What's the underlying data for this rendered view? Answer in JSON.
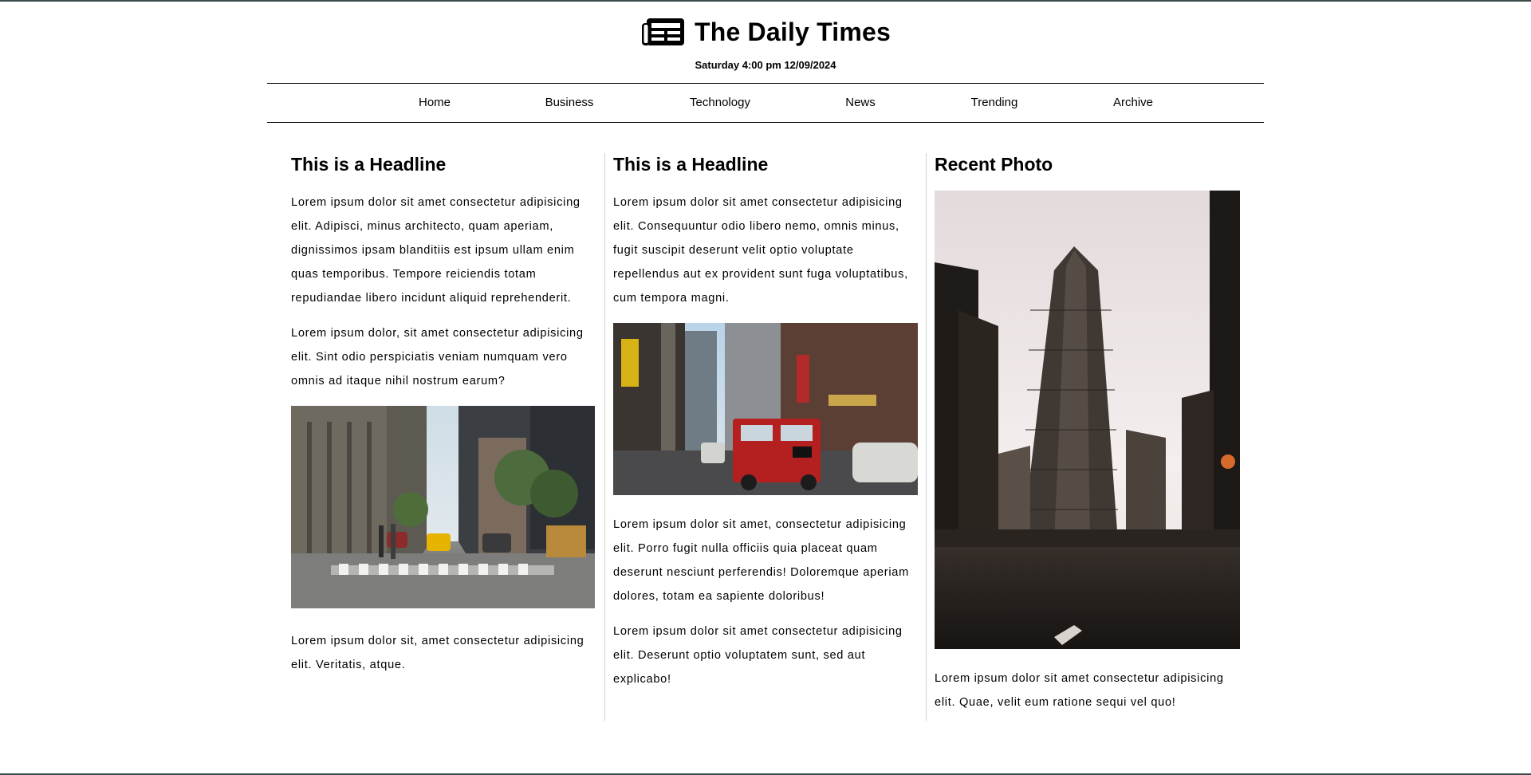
{
  "site": {
    "title": "The Daily Times",
    "dateline": "Saturday 4:00 pm 12/09/2024",
    "logo_icon": "newspaper-icon"
  },
  "nav": {
    "items": [
      {
        "label": "Home"
      },
      {
        "label": "Business"
      },
      {
        "label": "Technology"
      },
      {
        "label": "News"
      },
      {
        "label": "Trending"
      },
      {
        "label": "Archive"
      }
    ]
  },
  "columns": [
    {
      "headline": "This is a Headline",
      "paragraphs": [
        "Lorem ipsum dolor sit amet consectetur adipisicing elit. Adipisci, minus architecto, quam aperiam, dignissimos ipsam blanditiis est ipsum ullam enim quas temporibus. Tempore reiciendis totam repudiandae libero incidunt aliquid reprehenderit.",
        "Lorem ipsum dolor, sit amet consectetur adipisicing elit. Sint odio perspiciatis veniam numquam vero omnis ad itaque nihil nostrum earum?",
        "Lorem ipsum dolor sit, amet consectetur adipisicing elit. Veritatis, atque."
      ]
    },
    {
      "headline": "This is a Headline",
      "paragraphs": [
        "Lorem ipsum dolor sit amet consectetur adipisicing elit. Consequuntur odio libero nemo, omnis minus, fugit suscipit deserunt velit optio voluptate repellendus aut ex provident sunt fuga voluptatibus, cum tempora magni.",
        "Lorem ipsum dolor sit amet, consectetur adipisicing elit. Porro fugit nulla officiis quia placeat quam deserunt nesciunt perferendis! Doloremque aperiam dolores, totam ea sapiente doloribus!",
        "Lorem ipsum dolor sit amet consectetur adipisicing elit. Deserunt optio voluptatem sunt, sed aut explicabo!"
      ]
    },
    {
      "headline": "Recent Photo",
      "paragraphs": [
        "Lorem ipsum dolor sit amet consectetur adipisicing elit. Quae, velit eum ratione sequi vel quo!"
      ]
    }
  ],
  "colors": {
    "text": "#000000",
    "divider": "#cfcfcf",
    "rule": "#3a4a4a"
  }
}
